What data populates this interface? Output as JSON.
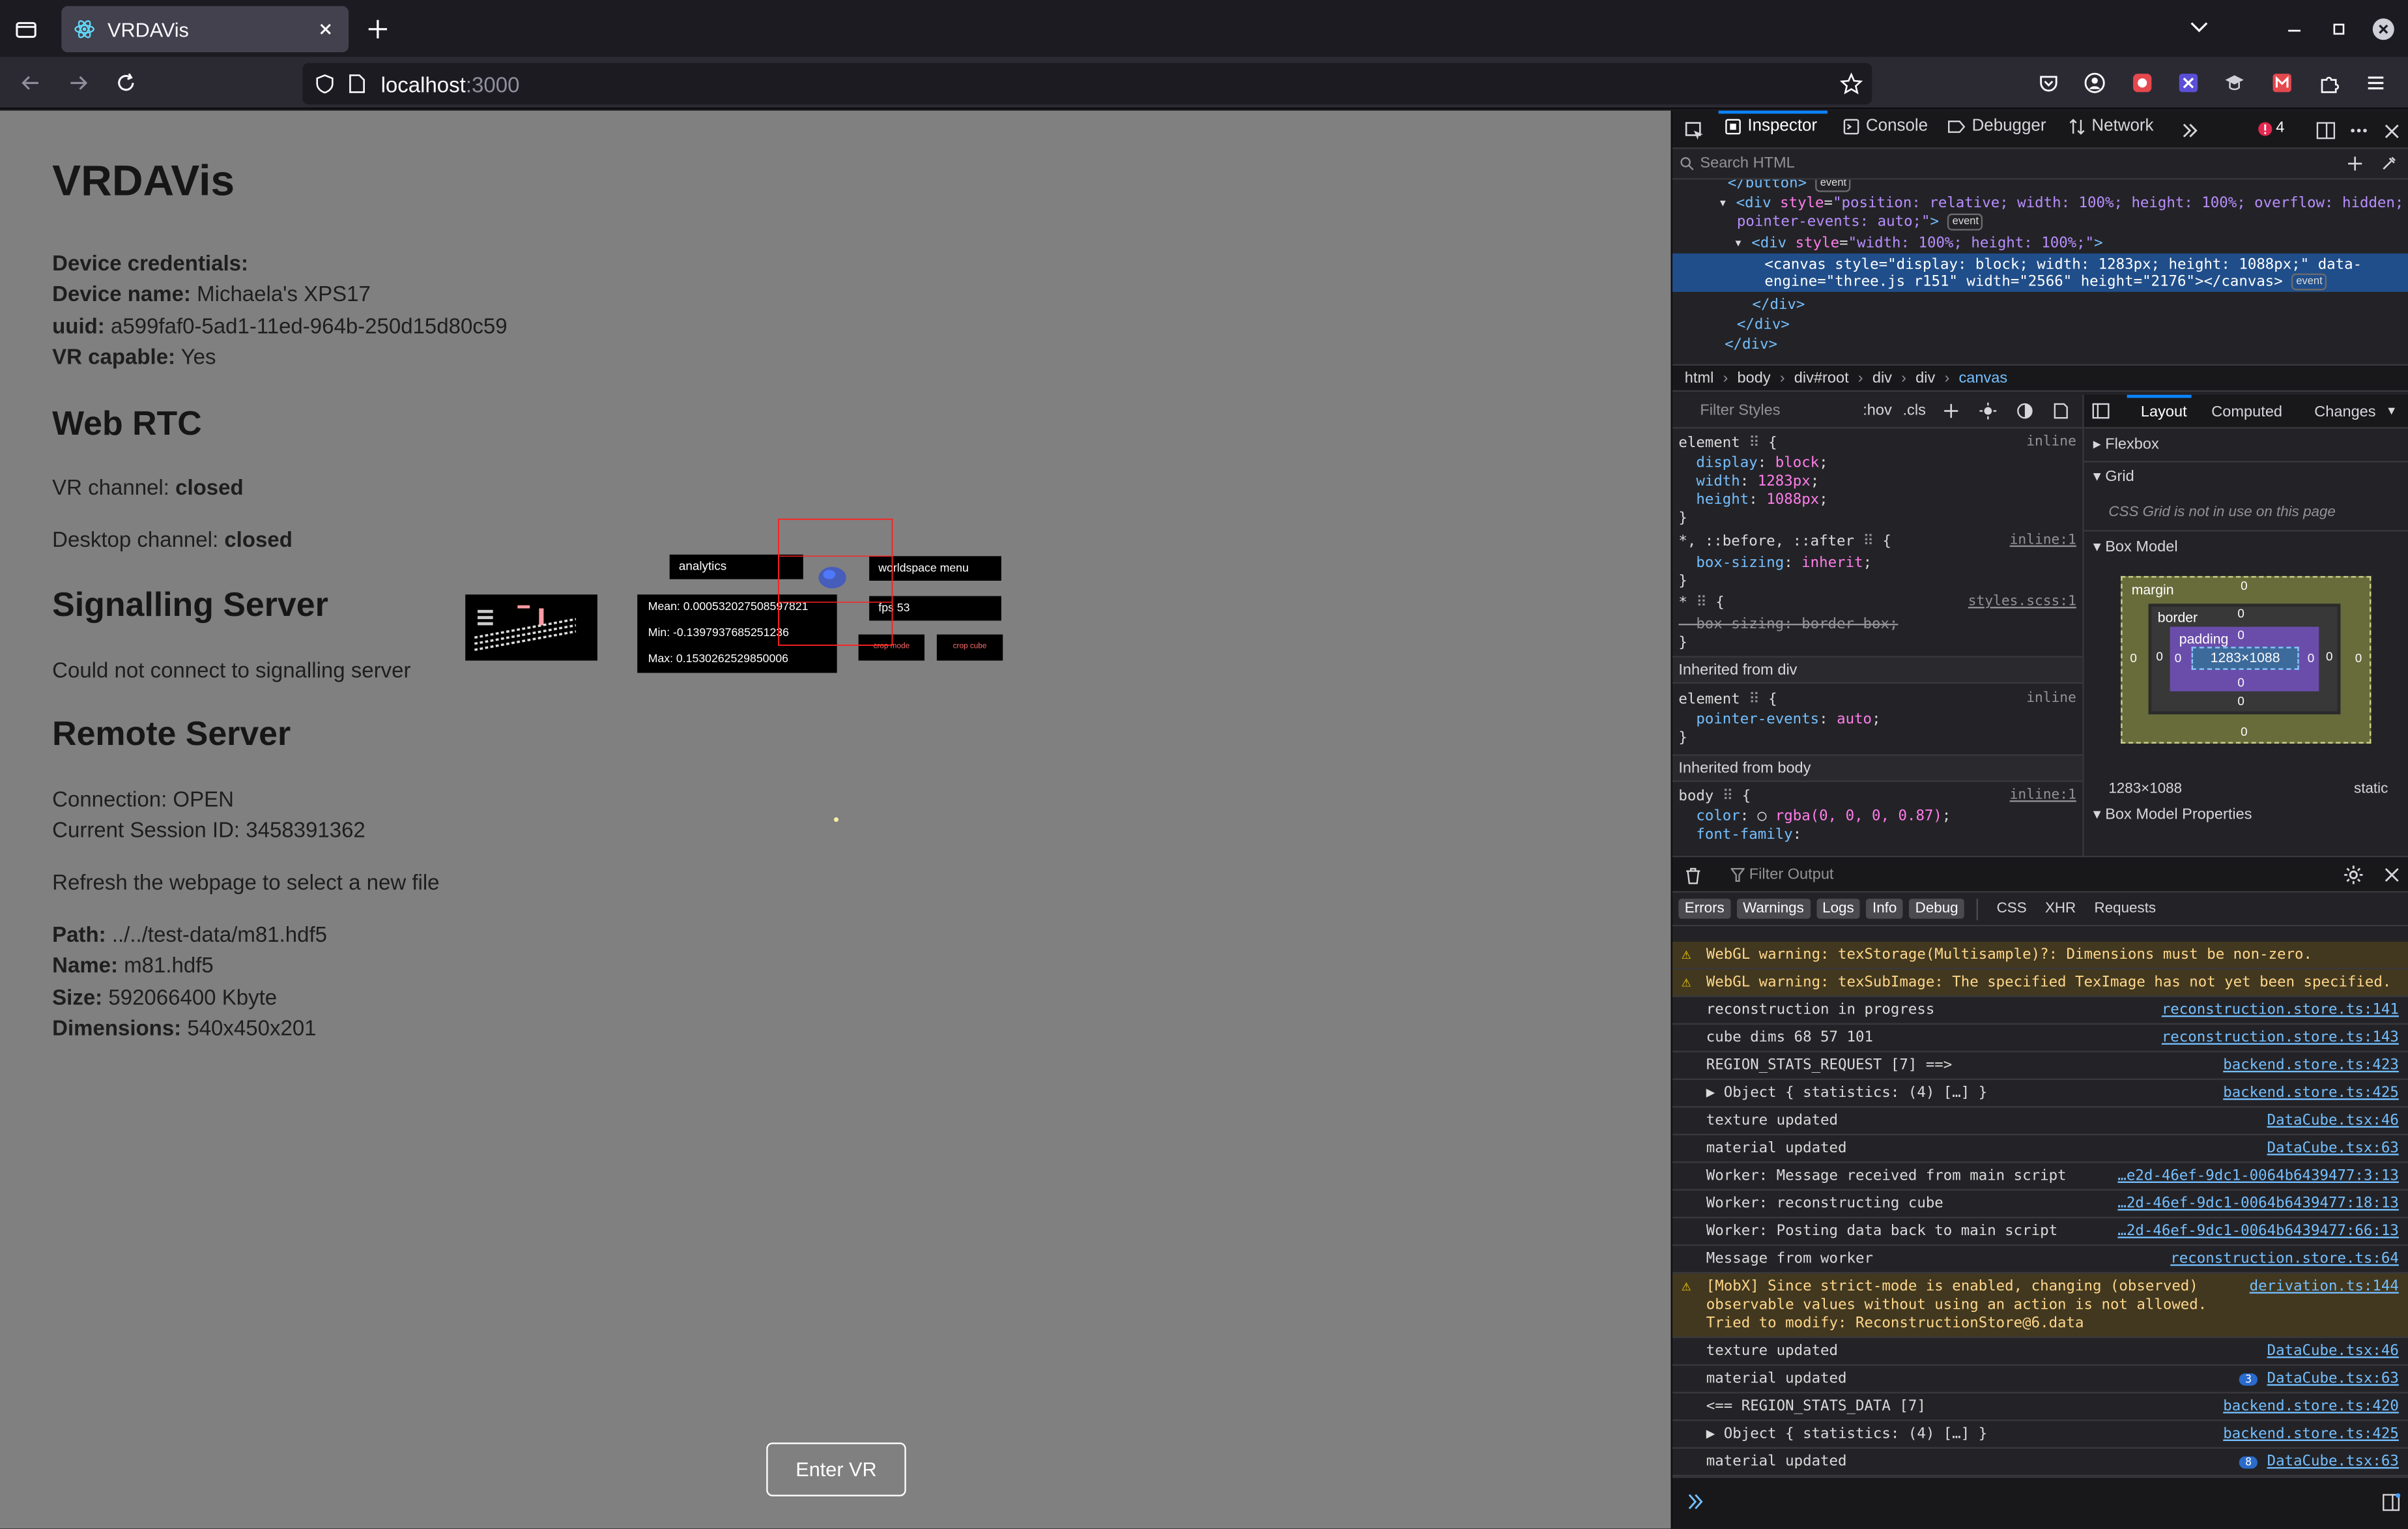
{
  "browser": {
    "tab_title": "VRDAVis",
    "url_host": "localhost",
    "url_port": ":3000"
  },
  "page": {
    "title": "VRDAVis",
    "device_heading": "Device credentials:",
    "device_name_label": "Device name:",
    "device_name": "Michaela's XPS17",
    "uuid_label": "uuid:",
    "uuid": "a599faf0-5ad1-11ed-964b-250d15d80c59",
    "vr_capable_label": "VR capable:",
    "vr_capable": "Yes",
    "webrtc_heading": "Web RTC",
    "vr_channel_label": "VR channel:",
    "vr_channel": "closed",
    "desktop_channel_label": "Desktop channel:",
    "desktop_channel": "closed",
    "signalling_heading": "Signalling Server",
    "signalling_status": "Could not connect to signalling server",
    "remote_heading": "Remote Server",
    "connection": "Connection: OPEN",
    "session": "Current Session ID: 3458391362",
    "refresh_note": "Refresh the webpage to select a new file",
    "path_label": "Path:",
    "path": "../../test-data/m81.hdf5",
    "name_label": "Name:",
    "name": "m81.hdf5",
    "size_label": "Size:",
    "size": "592066400 Kbyte",
    "dims_label": "Dimensions:",
    "dims": "540x450x201",
    "enter_vr": "Enter VR"
  },
  "scene": {
    "analytics": "analytics",
    "workspace_menu": "worldspace menu",
    "fps": "fps 53",
    "mean": "Mean: 0.000532027508597821",
    "min": "Min: -0.1397937685251236",
    "max": "Max: 0.1530262529850006",
    "crop_mode": "crop mode",
    "crop_cube": "crop cube"
  },
  "devtools": {
    "tabs": [
      "Inspector",
      "Console",
      "Debugger",
      "Network"
    ],
    "error_count": "4",
    "search_placeholder": "Search HTML",
    "crumbs": [
      "html",
      "body",
      "div#root",
      "div",
      "div",
      "canvas"
    ],
    "filter_styles": "Filter Styles",
    "hov": ":hov",
    "cls": ".cls",
    "layout_tabs": [
      "Layout",
      "Computed",
      "Changes"
    ],
    "flexbox": "Flexbox",
    "grid": "Grid",
    "grid_note": "CSS Grid is not in use on this page",
    "box_model": "Box Model",
    "box_model_props": "Box Model Properties",
    "box_size": "1283×1088",
    "box_size_footer": "1283×1088",
    "position": "static",
    "margin_label": "margin",
    "border_label": "border",
    "padding_label": "padding",
    "zero": "0",
    "filter_output": "Filter Output",
    "filters": [
      "Errors",
      "Warnings",
      "Logs",
      "Info",
      "Debug"
    ],
    "filters_plain": [
      "CSS",
      "XHR",
      "Requests"
    ],
    "inherited_div": "Inherited from div",
    "inherited_body": "Inherited from body",
    "console": [
      {
        "type": "warn",
        "text": "WebGL warning: texStorage(Multisample)?: Dimensions must be non-zero.",
        "src": ""
      },
      {
        "type": "warn",
        "text": "WebGL warning: texSubImage: The specified TexImage has not yet been specified.",
        "src": ""
      },
      {
        "type": "log",
        "text": "reconstruction in progress",
        "src": "reconstruction.store.ts:141"
      },
      {
        "type": "log",
        "text": "cube dims 68 57 101",
        "src": "reconstruction.store.ts:143"
      },
      {
        "type": "log",
        "text": "REGION_STATS_REQUEST [7] ==>",
        "src": "backend.store.ts:423"
      },
      {
        "type": "log",
        "text": "▶ Object { statistics: (4) […] }",
        "src": "backend.store.ts:425"
      },
      {
        "type": "log",
        "text": "texture updated",
        "src": "DataCube.tsx:46"
      },
      {
        "type": "log",
        "text": "material updated",
        "src": "DataCube.tsx:63"
      },
      {
        "type": "log",
        "text": "Worker: Message received from main script",
        "src": "…e2d-46ef-9dc1-0064b6439477:3:13"
      },
      {
        "type": "log",
        "text": "Worker: reconstructing cube",
        "src": "…2d-46ef-9dc1-0064b6439477:18:13"
      },
      {
        "type": "log",
        "text": "Worker: Posting data back to main script",
        "src": "…2d-46ef-9dc1-0064b6439477:66:13"
      },
      {
        "type": "log",
        "text": "Message from worker",
        "src": "reconstruction.store.ts:64"
      },
      {
        "type": "warn3",
        "text": "[MobX] Since strict-mode is enabled, changing (observed)\nobservable values without using an action is not allowed.\nTried to modify: ReconstructionStore@6.data",
        "src": "derivation.ts:144"
      },
      {
        "type": "log",
        "text": "texture updated",
        "src": "DataCube.tsx:46"
      },
      {
        "type": "log",
        "text": "material updated",
        "src": "DataCube.tsx:63",
        "count": "3"
      },
      {
        "type": "log",
        "text": "<== REGION_STATS_DATA [7]",
        "src": "backend.store.ts:420"
      },
      {
        "type": "log",
        "text": "▶ Object { statistics: (4) […] }",
        "src": "backend.store.ts:425"
      },
      {
        "type": "log",
        "text": "material updated",
        "src": "DataCube.tsx:63",
        "count": "8"
      }
    ]
  }
}
